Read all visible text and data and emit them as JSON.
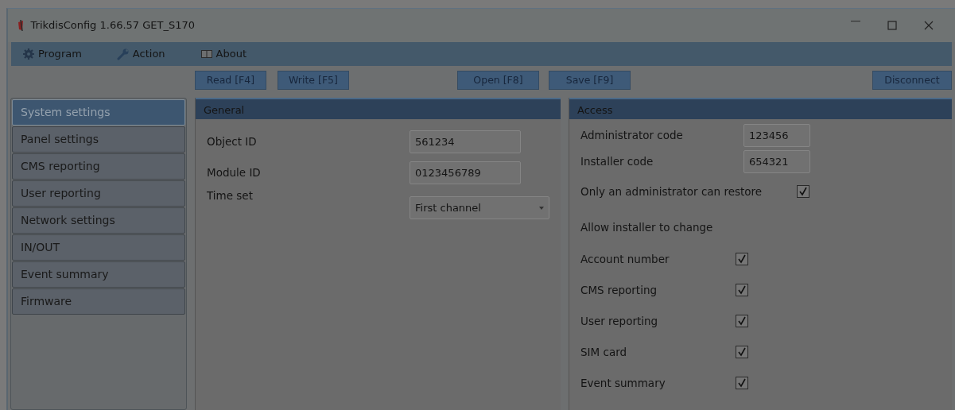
{
  "window": {
    "title": "TrikdisConfig 1.66.57   GET_S170"
  },
  "menu": [
    {
      "label": "Program",
      "kind": "gear"
    },
    {
      "label": "Action",
      "kind": "wrench"
    },
    {
      "label": "About",
      "kind": "book"
    }
  ],
  "toolbar": {
    "left": [
      "Read [F4]",
      "Write [F5]"
    ],
    "middle": [
      "Open [F8]",
      "Save [F9]"
    ],
    "right": [
      "Disconnect"
    ]
  },
  "sidebar": {
    "items": [
      {
        "label": "System settings",
        "selected": true
      },
      {
        "label": "Panel settings",
        "selected": false
      },
      {
        "label": "CMS reporting",
        "selected": false
      },
      {
        "label": "User reporting",
        "selected": false
      },
      {
        "label": "Network settings",
        "selected": false
      },
      {
        "label": "IN/OUT",
        "selected": false
      },
      {
        "label": "Event summary",
        "selected": false
      },
      {
        "label": "Firmware",
        "selected": false
      }
    ]
  },
  "general": {
    "title": "General",
    "fields": [
      {
        "label": "Object ID",
        "kind": "text",
        "value": "561234"
      },
      {
        "label": "Module ID",
        "kind": "text",
        "value": "0123456789"
      },
      {
        "label": "Time set",
        "kind": "select",
        "value": "First channel"
      }
    ]
  },
  "access": {
    "title": "Access",
    "fields": [
      {
        "label": "Administrator code",
        "value": "123456"
      },
      {
        "label": "Installer code",
        "value": "654321"
      }
    ],
    "restore": {
      "label": "Only an administrator can restore",
      "checked": true
    },
    "allow_title": "Allow installer to change",
    "allow": [
      {
        "label": "Account number",
        "checked": true
      },
      {
        "label": "CMS reporting",
        "checked": true
      },
      {
        "label": "User reporting",
        "checked": true
      },
      {
        "label": "SIM card",
        "checked": true
      },
      {
        "label": "Event summary",
        "checked": true
      }
    ]
  }
}
